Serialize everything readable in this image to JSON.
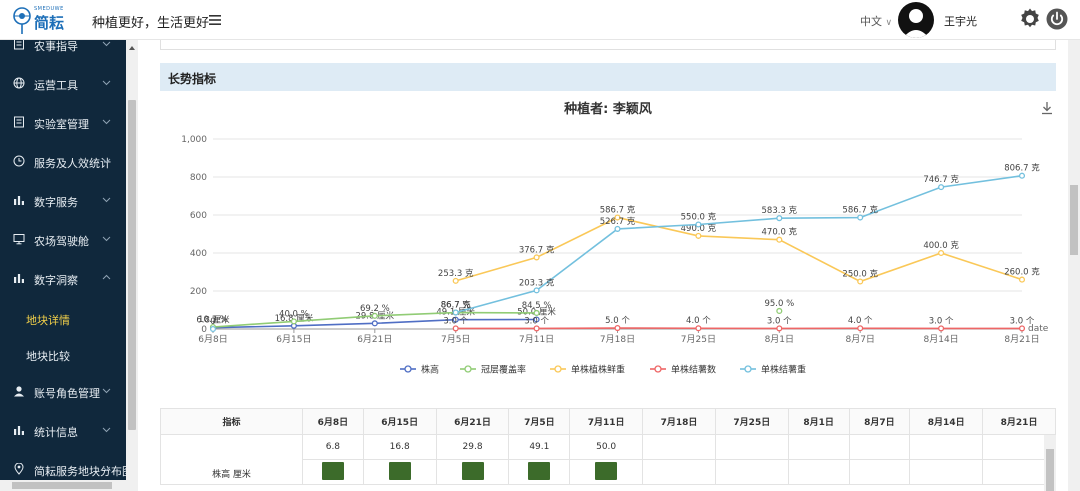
{
  "header": {
    "logo_sub": "SMEDUWE",
    "logo_name": "简耘",
    "slogan": "种植更好，生活更好",
    "language": "中文",
    "username": "王宇光"
  },
  "sidebar": {
    "items": [
      {
        "label": "农事指导",
        "icon": "document-icon",
        "expanded": false
      },
      {
        "label": "运营工具",
        "icon": "globe-icon",
        "expanded": false
      },
      {
        "label": "实验室管理",
        "icon": "document-icon",
        "expanded": false
      },
      {
        "label": "服务及人效统计",
        "icon": "clock-icon",
        "expanded": false
      },
      {
        "label": "数字服务",
        "icon": "bar-chart-icon",
        "expanded": false
      },
      {
        "label": "农场驾驶舱",
        "icon": "monitor-icon",
        "expanded": false
      },
      {
        "label": "数字洞察",
        "icon": "bar-chart-icon",
        "expanded": true
      },
      {
        "label": "账号角色管理",
        "icon": "user-icon",
        "expanded": false
      },
      {
        "label": "统计信息",
        "icon": "bar-chart-icon",
        "expanded": false
      },
      {
        "label": "简耘服务地块分布图",
        "icon": "location-icon",
        "expanded": false
      }
    ],
    "subitems": [
      {
        "label": "地块详情",
        "active": true
      },
      {
        "label": "地块比较",
        "active": false
      }
    ]
  },
  "section": {
    "title": "长势指标"
  },
  "chart_data": {
    "type": "line",
    "title": "种植者: 李颖风",
    "xlabel": "date",
    "categories": [
      "6月8日",
      "6月15日",
      "6月21日",
      "7月5日",
      "7月11日",
      "7月18日",
      "7月25日",
      "8月1日",
      "8月7日",
      "8月14日",
      "8月21日"
    ],
    "ylim": [
      0,
      1000
    ],
    "yticks": [
      0,
      200,
      400,
      600,
      800,
      1000
    ],
    "ytick_labels": [
      "0",
      "200",
      "400",
      "600",
      "800",
      "1,000"
    ],
    "grid": true,
    "legend_position": "bottom",
    "series": [
      {
        "name": "株高",
        "color": "#4f6ec4",
        "values": [
          6.8,
          16.8,
          29.8,
          49.1,
          50.0,
          null,
          null,
          null,
          null,
          null,
          null
        ],
        "labels": [
          "6.8 厘米",
          "16.8 厘米",
          "29.8 厘米",
          "49.1 厘米",
          "50.0 厘米",
          "",
          "",
          "",
          "",
          "",
          ""
        ]
      },
      {
        "name": "冠层覆盖率",
        "color": "#91cc75",
        "values": [
          10.3,
          40.0,
          69.2,
          86.7,
          84.5,
          null,
          null,
          95.0,
          null,
          null,
          null
        ],
        "labels": [
          "10.3 %",
          "40.0 %",
          "69.2 %",
          "86.7 %",
          "84.5 %",
          "",
          "",
          "95.0 %",
          "",
          "",
          ""
        ]
      },
      {
        "name": "单株植株鲜重",
        "color": "#fac858",
        "values": [
          null,
          null,
          null,
          253.3,
          376.7,
          586.7,
          490.0,
          470.0,
          250.0,
          400.0,
          260.0
        ],
        "labels": [
          "",
          "",
          "",
          "253.3 克",
          "376.7 克",
          "586.7 克",
          "490.0 克",
          "470.0 克",
          "250.0 克",
          "400.0 克",
          "260.0 克"
        ]
      },
      {
        "name": "单株结薯数",
        "color": "#ee6666",
        "values": [
          null,
          null,
          null,
          3.0,
          3.0,
          5.0,
          4.0,
          3.0,
          4.0,
          3.0,
          3.0
        ],
        "labels": [
          "",
          "",
          "",
          "3.0 个",
          "3.0 个",
          "5.0 个",
          "4.0 个",
          "3.0 个",
          "4.0 个",
          "3.0 个",
          "3.0 个"
        ]
      },
      {
        "name": "单株结薯重",
        "color": "#73c0de",
        "values": [
          0,
          null,
          null,
          86.7,
          203.3,
          526.7,
          550.0,
          583.3,
          586.7,
          746.7,
          806.7
        ],
        "labels": [
          "0",
          "",
          "",
          "86.7 克",
          "203.3 克",
          "526.7 克",
          "550.0 克",
          "583.3 克",
          "586.7 克",
          "746.7 克",
          "806.7 克"
        ]
      }
    ]
  },
  "table": {
    "headers": [
      "指标",
      "6月8日",
      "6月15日",
      "6月21日",
      "7月5日",
      "7月11日",
      "7月18日",
      "7月25日",
      "8月1日",
      "8月7日",
      "8月14日",
      "8月21日"
    ],
    "row_label": "株高 厘米",
    "values": [
      "6.8",
      "16.8",
      "29.8",
      "49.1",
      "50.0",
      "",
      "",
      "",
      "",
      "",
      ""
    ],
    "has_image": [
      true,
      true,
      true,
      true,
      true,
      false,
      false,
      false,
      false,
      false,
      false
    ]
  }
}
